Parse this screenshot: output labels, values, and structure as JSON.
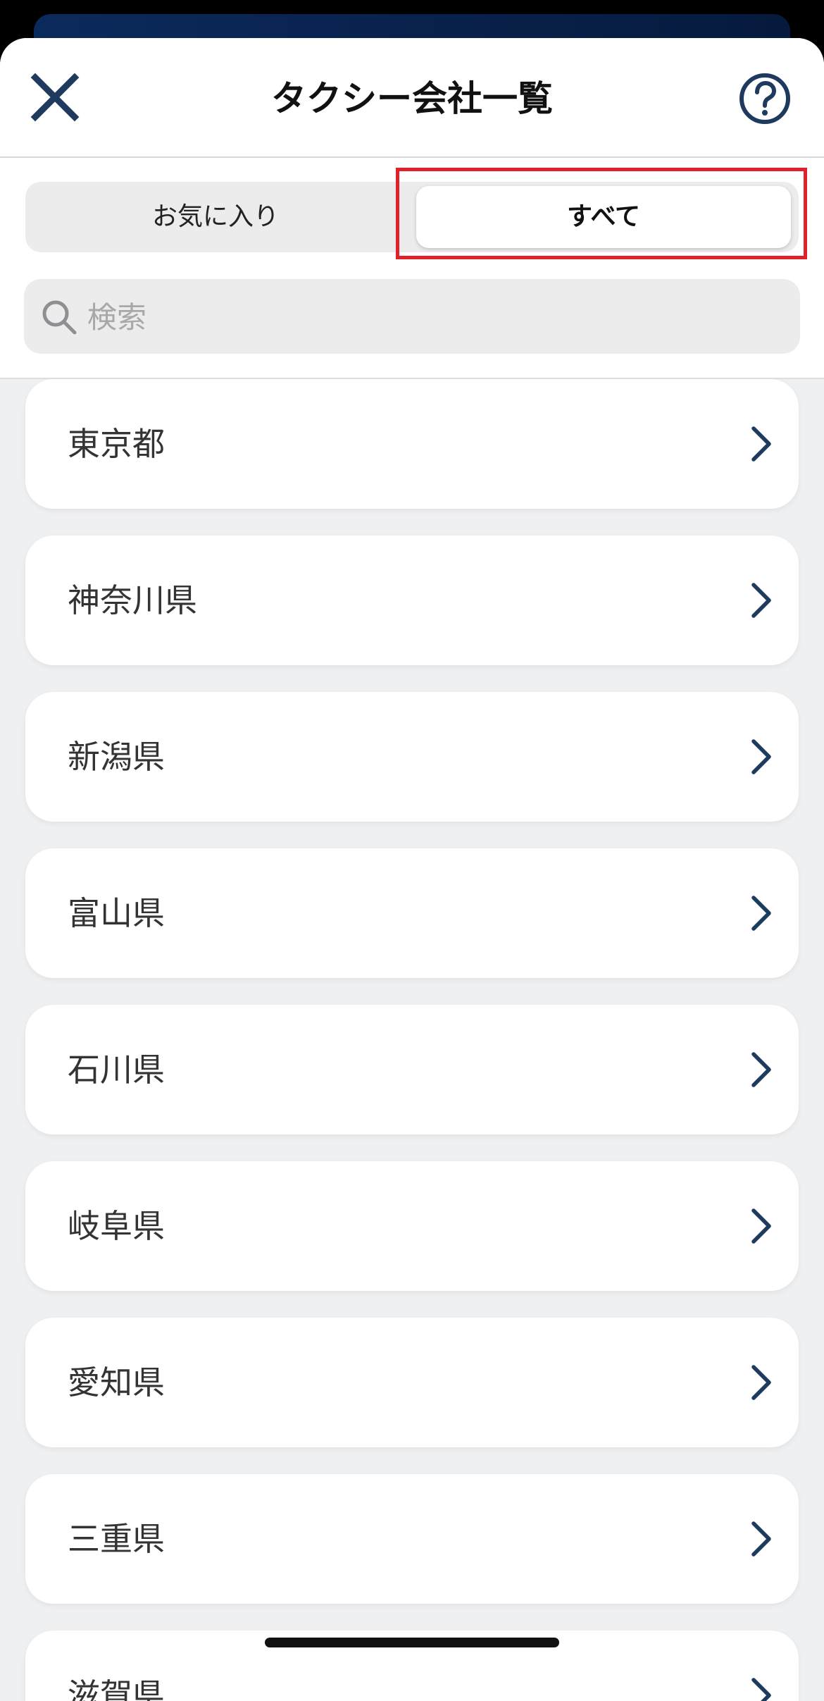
{
  "header": {
    "title": "タクシー会社一覧",
    "close_icon": "close-icon",
    "help_icon": "question-circle-icon"
  },
  "tabs": {
    "favorites_label": "お気に入り",
    "all_label": "すべて",
    "selected": "すべて"
  },
  "search": {
    "placeholder": "検索",
    "value": ""
  },
  "prefectures": [
    {
      "label": "東京都"
    },
    {
      "label": "神奈川県"
    },
    {
      "label": "新潟県"
    },
    {
      "label": "富山県"
    },
    {
      "label": "石川県"
    },
    {
      "label": "岐阜県"
    },
    {
      "label": "愛知県"
    },
    {
      "label": "三重県"
    },
    {
      "label": "滋賀県"
    }
  ],
  "colors": {
    "accent_navy": "#1f3a5f",
    "highlight_red": "#e0202a"
  }
}
